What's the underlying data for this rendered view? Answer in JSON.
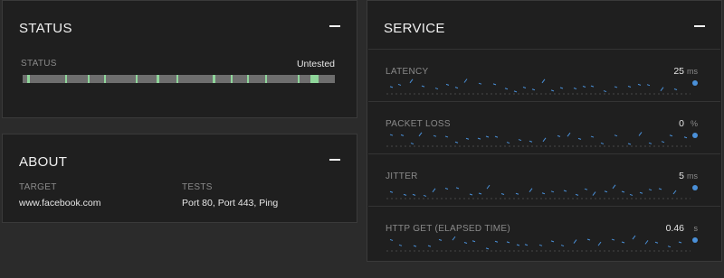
{
  "status": {
    "title": "STATUS",
    "label": "STATUS",
    "value": "Untested",
    "colors": {
      "track": "#6e6e6e",
      "ok": "#8fd59a"
    }
  },
  "about": {
    "title": "ABOUT",
    "target_label": "TARGET",
    "target_value": "www.facebook.com",
    "tests_label": "TESTS",
    "tests_value": "Port 80, Port 443, Ping"
  },
  "service": {
    "title": "SERVICE",
    "accent": "#4a90d9",
    "metrics": [
      {
        "label": "LATENCY",
        "value": "25",
        "unit": "ms"
      },
      {
        "label": "PACKET LOSS",
        "value": "0",
        "unit": "%"
      },
      {
        "label": "JITTER",
        "value": "5",
        "unit": "ms"
      },
      {
        "label": "HTTP GET (ELAPSED TIME)",
        "value": "0.46",
        "unit": "s"
      }
    ]
  }
}
